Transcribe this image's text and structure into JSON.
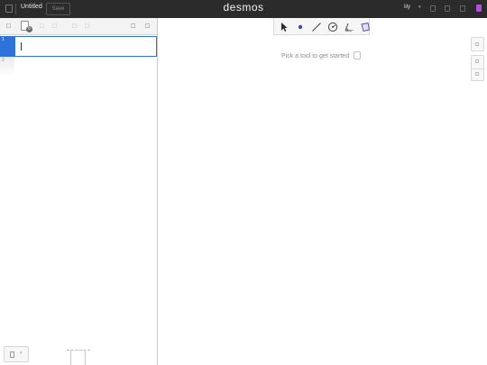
{
  "header": {
    "menu_icon": "hamburger-icon",
    "title": "Untitled",
    "save_label": "Save",
    "logo": "desmos",
    "user": "lily",
    "user_caret": "▾",
    "help_icon": "help-icon",
    "language_icon": "globe-icon",
    "share_icon": "share-icon",
    "accent_color": "#b04fd8"
  },
  "expressions": {
    "rows": [
      {
        "number": "1",
        "value": ""
      },
      {
        "number": "2",
        "value": ""
      }
    ],
    "active_color": "#2f72dc"
  },
  "tools": {
    "items": [
      {
        "name": "pointer",
        "icon": "cursor-arrow-icon"
      },
      {
        "name": "point",
        "icon": "point-icon"
      },
      {
        "name": "segment",
        "icon": "line-segment-icon"
      },
      {
        "name": "circle",
        "icon": "circle-icon"
      },
      {
        "name": "angle",
        "icon": "angle-icon"
      },
      {
        "name": "polygon",
        "icon": "polygon-icon"
      }
    ]
  },
  "graph": {
    "hint": "Pick a tool to get started"
  },
  "bottom": {
    "keypad_caret": "▾"
  }
}
